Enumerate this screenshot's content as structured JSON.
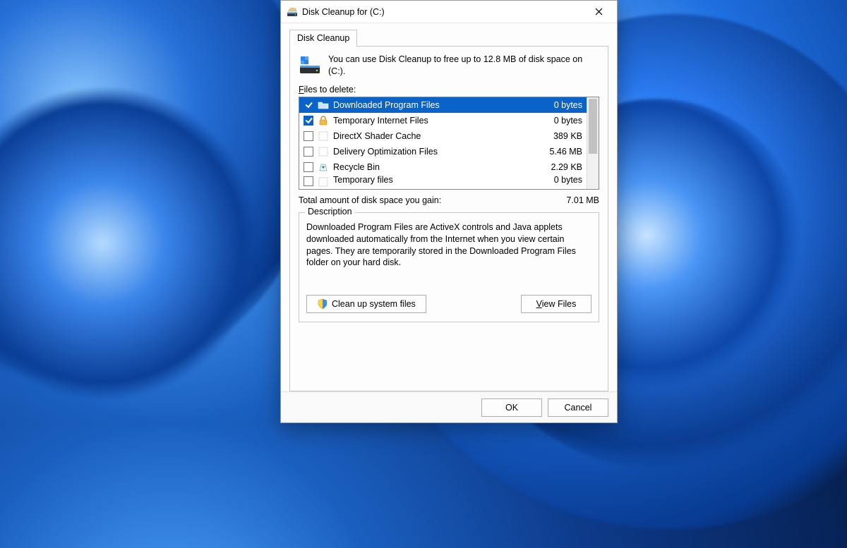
{
  "window": {
    "title": "Disk Cleanup for  (C:)"
  },
  "tab": {
    "label": "Disk Cleanup"
  },
  "intro": "You can use Disk Cleanup to free up to 12.8 MB of disk space on  (C:).",
  "files_label_pre": "F",
  "files_label_post": "iles to delete:",
  "items": [
    {
      "checked": true,
      "icon": "folder",
      "name": "Downloaded Program Files",
      "size": "0 bytes",
      "selected": true
    },
    {
      "checked": true,
      "icon": "lock",
      "name": "Temporary Internet Files",
      "size": "0 bytes",
      "selected": false
    },
    {
      "checked": false,
      "icon": "blank",
      "name": "DirectX Shader Cache",
      "size": "389 KB",
      "selected": false
    },
    {
      "checked": false,
      "icon": "blank",
      "name": "Delivery Optimization Files",
      "size": "5.46 MB",
      "selected": false
    },
    {
      "checked": false,
      "icon": "recycle",
      "name": "Recycle Bin",
      "size": "2.29 KB",
      "selected": false
    },
    {
      "checked": false,
      "icon": "blank",
      "name": "Temporary files",
      "size": "0 bytes",
      "selected": false
    }
  ],
  "total": {
    "label": "Total amount of disk space you gain:",
    "value": "7.01 MB"
  },
  "description": {
    "title": "Description",
    "text": "Downloaded Program Files are ActiveX controls and Java applets downloaded automatically from the Internet when you view certain pages. They are temporarily stored in the Downloaded Program Files folder on your hard disk."
  },
  "buttons": {
    "cleanup_pre": "",
    "cleanup": "Clean up system files",
    "view_pre": "V",
    "view_post": "iew Files",
    "ok": "OK",
    "cancel": "Cancel"
  }
}
